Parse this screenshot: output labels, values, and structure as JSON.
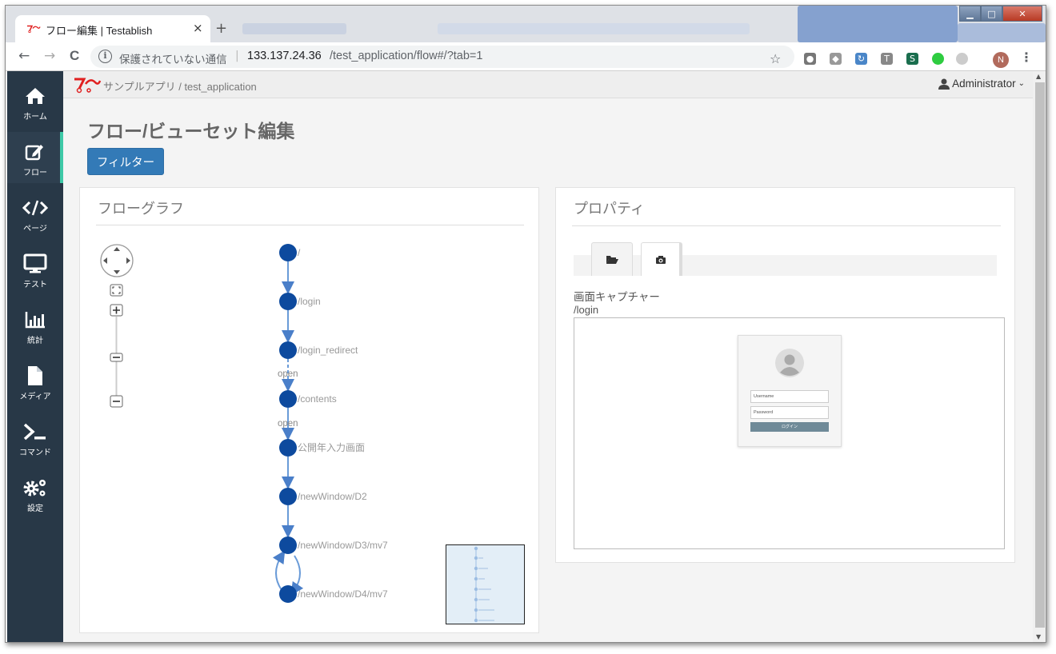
{
  "browser": {
    "tab_title": "フロー編集 | Testablish",
    "tab_close": "×",
    "new_tab": "+",
    "back": "←",
    "forward": "→",
    "reload": "C",
    "info": "i",
    "security_text": "保護されていない通信",
    "separator": "|",
    "url_host": "133.137.24.36",
    "url_path": "/test_application/flow#/?tab=1",
    "star": "☆",
    "avatar_letter": "N",
    "menu": "⋮",
    "window_min": "▁",
    "window_max": "□",
    "window_close": "✕"
  },
  "sidebar": {
    "items": [
      {
        "label": "ホーム",
        "icon": "home-icon"
      },
      {
        "label": "フロー",
        "icon": "edit-icon"
      },
      {
        "label": "ページ",
        "icon": "code-icon"
      },
      {
        "label": "テスト",
        "icon": "monitor-icon"
      },
      {
        "label": "統計",
        "icon": "bar-chart-icon"
      },
      {
        "label": "メディア",
        "icon": "file-icon"
      },
      {
        "label": "コマンド",
        "icon": "terminal-icon"
      },
      {
        "label": "設定",
        "icon": "gears-icon"
      }
    ]
  },
  "header": {
    "breadcrumb": "サンプルアプリ / test_application",
    "user": "Administrator",
    "caret": "⌄"
  },
  "main": {
    "page_title": "フロー/ビューセット編集",
    "filter_button": "フィルター"
  },
  "flow_graph": {
    "title": "フローグラフ",
    "nodes": [
      "/",
      "/login",
      "/login_redirect",
      "/contents",
      "公開年入力画面",
      "/newWindow/D2",
      "/newWindow/D3/mv7",
      "/newWindow/D4/mv7"
    ],
    "edge_labels": [
      {
        "after_node": 2,
        "label": "open"
      },
      {
        "after_node": 3,
        "label": "open"
      }
    ]
  },
  "properties": {
    "title": "プロパティ",
    "tabs": [
      {
        "icon": "folder-open-icon",
        "active": false
      },
      {
        "icon": "camera-icon",
        "active": true
      }
    ],
    "capture_heading": "画面キャプチャー",
    "capture_path": "/login",
    "login_preview": {
      "username_placeholder": "Username",
      "password_placeholder": "Password",
      "login_button": "ログイン"
    }
  },
  "colors": {
    "sidebar_bg": "#283847",
    "sidebar_active": "#3ec9a7",
    "node": "#0d4a9e",
    "edge": "#6a9bd8",
    "primary_button": "#337ab7"
  }
}
